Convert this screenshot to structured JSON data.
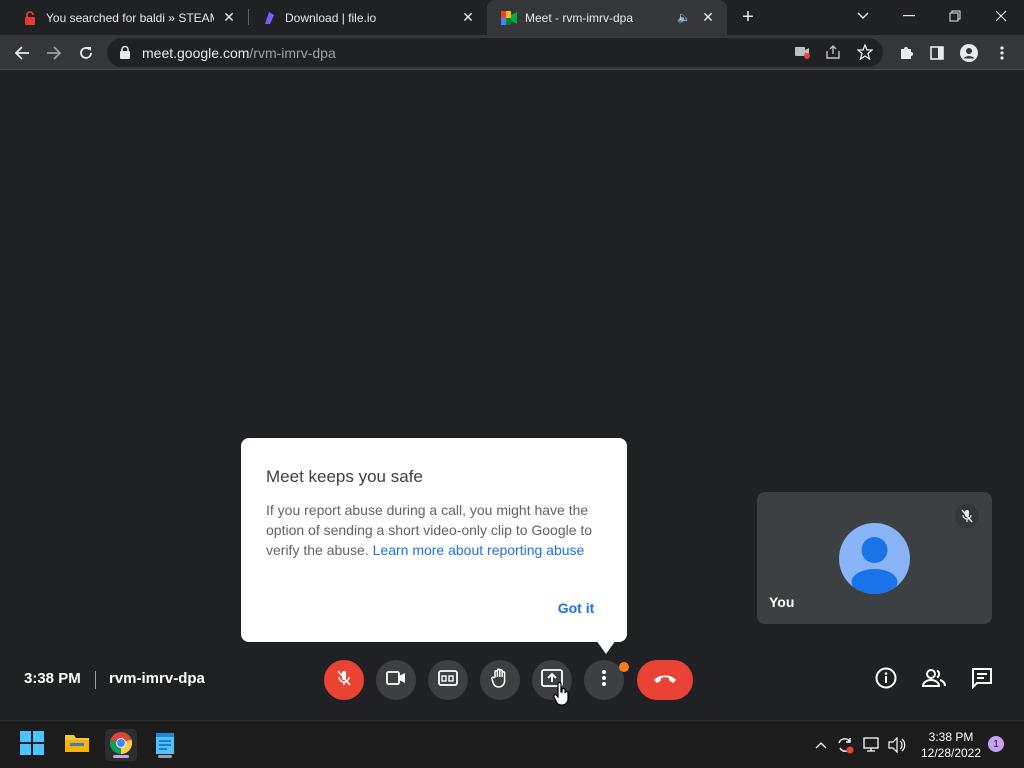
{
  "browser": {
    "tabs": [
      {
        "title": "You searched for baldi » STEAMUNLOCKED",
        "icon": "steamunlocked-lock-favicon",
        "active": false
      },
      {
        "title": "Download | file.io",
        "icon": "fileio-favicon",
        "active": false
      },
      {
        "title": "Meet - rvm-imrv-dpa",
        "icon": "google-meet-favicon",
        "active": true,
        "audio": "speaker-icon"
      }
    ],
    "url_host": "meet.google.com",
    "url_path": "/rvm-imrv-dpa"
  },
  "meet": {
    "self_tile": {
      "name": "You",
      "muted": true
    },
    "popup": {
      "title": "Meet keeps you safe",
      "body": "If you report abuse during a call, you might have the option of sending a short video-only clip to Google to verify the abuse.",
      "link": "Learn more about reporting abuse",
      "button": "Got it"
    },
    "time": "3:38 PM",
    "meeting_code": "rvm-imrv-dpa",
    "controls": [
      "mic-off",
      "camera",
      "captions",
      "raise-hand",
      "present",
      "more-options",
      "end-call"
    ],
    "right_controls": [
      "meeting-info",
      "people",
      "chat"
    ],
    "accent_colors": {
      "red": "#ea4335",
      "blue": "#1a73e8",
      "notification": "#fa7b17"
    }
  },
  "taskbar": {
    "apps": [
      "windows-start",
      "file-explorer",
      "google-chrome",
      "notepad"
    ],
    "clock_time": "3:38 PM",
    "clock_date": "12/28/2022",
    "notification_count": "1"
  }
}
